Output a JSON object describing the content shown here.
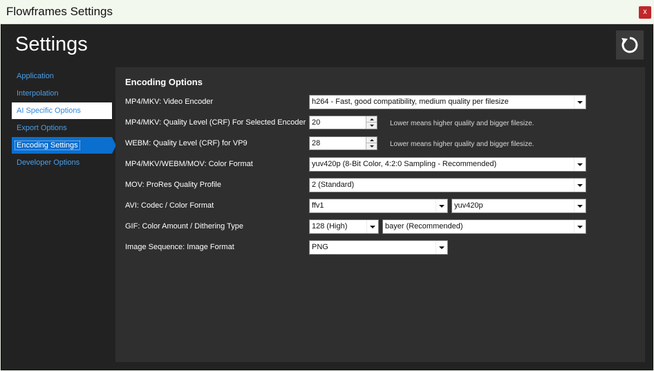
{
  "window": {
    "title": "Flowframes Settings",
    "close_label": "x"
  },
  "header": {
    "title": "Settings",
    "reset_icon": "reset-icon"
  },
  "sidebar": {
    "items": [
      {
        "label": "Application"
      },
      {
        "label": "Interpolation"
      },
      {
        "label": "AI Specific Options"
      },
      {
        "label": "Export Options"
      },
      {
        "label": "Encoding Settings"
      },
      {
        "label": "Developer Options"
      }
    ],
    "active_index": 4
  },
  "main": {
    "section_title": "Encoding Options",
    "rows": [
      {
        "label": "MP4/MKV: Video Encoder",
        "value": "h264 - Fast, good compatibility, medium quality per filesize"
      },
      {
        "label": "MP4/MKV: Quality Level (CRF) For Selected Encoder",
        "value": "20",
        "hint": "Lower means higher quality and bigger filesize."
      },
      {
        "label": "WEBM: Quality Level (CRF) for VP9",
        "value": "28",
        "hint": "Lower means higher quality and bigger filesize."
      },
      {
        "label": "MP4/MKV/WEBM/MOV: Color Format",
        "value": "yuv420p (8-Bit Color, 4:2:0 Sampling - Recommended)"
      },
      {
        "label": "MOV: ProRes Quality Profile",
        "value": "2 (Standard)"
      },
      {
        "label": "AVI: Codec / Color Format",
        "value": "ffv1",
        "value2": "yuv420p"
      },
      {
        "label": "GIF: Color Amount / Dithering Type",
        "value": "128 (High)",
        "value2": "bayer (Recommended)"
      },
      {
        "label": "Image Sequence: Image Format",
        "value": "PNG"
      }
    ]
  },
  "colors": {
    "accent": "#0a6fcf",
    "background": "#222222",
    "panel": "#2f2f2f",
    "link": "#4a9fe8"
  }
}
